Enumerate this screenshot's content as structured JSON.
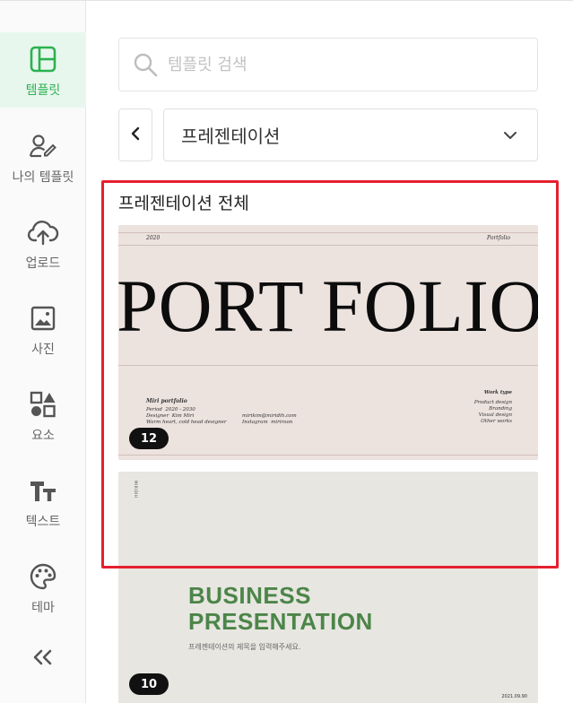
{
  "sidebar": {
    "items": [
      {
        "label": "템플릿",
        "icon": "layout-template-icon",
        "active": true
      },
      {
        "label": "나의 템플릿",
        "icon": "user-edit-icon",
        "active": false
      },
      {
        "label": "업로드",
        "icon": "cloud-upload-icon",
        "active": false
      },
      {
        "label": "사진",
        "icon": "image-icon",
        "active": false
      },
      {
        "label": "요소",
        "icon": "shapes-icon",
        "active": false
      },
      {
        "label": "텍스트",
        "icon": "text-icon",
        "active": false
      },
      {
        "label": "테마",
        "icon": "palette-icon",
        "active": false
      }
    ],
    "collapse_icon": "double-chevron-left-icon"
  },
  "search": {
    "placeholder": "템플릿 검색",
    "value": ""
  },
  "category": {
    "selected": "프레젠테이션"
  },
  "section": {
    "title": "프레젠테이션 전체"
  },
  "templates": [
    {
      "count": "12",
      "year": "2020",
      "tag": "Portfolio",
      "headline": "PORT FOLIO",
      "name": "Miri portfolio",
      "details": "Period  2020 - 2030\nDesigner  Kim Miri\nWarm heart, cold head designer",
      "contact": "mirikim@miridih.com\nInstagram  miriroon",
      "work_title": "Work type",
      "work_items": "Product design\nBranding\nVisual design\nOther works"
    },
    {
      "count": "10",
      "side_label": "MIRIDIH",
      "headline_line1": "BUSINESS",
      "headline_line2": "PRESENTATION",
      "subtitle": "프레젠테이션의 제목을 입력해주세요.",
      "date": "2021.09.90"
    }
  ],
  "colors": {
    "accent_green": "#2cb24f",
    "highlight_red": "#e5202f",
    "business_green": "#4c8548"
  }
}
